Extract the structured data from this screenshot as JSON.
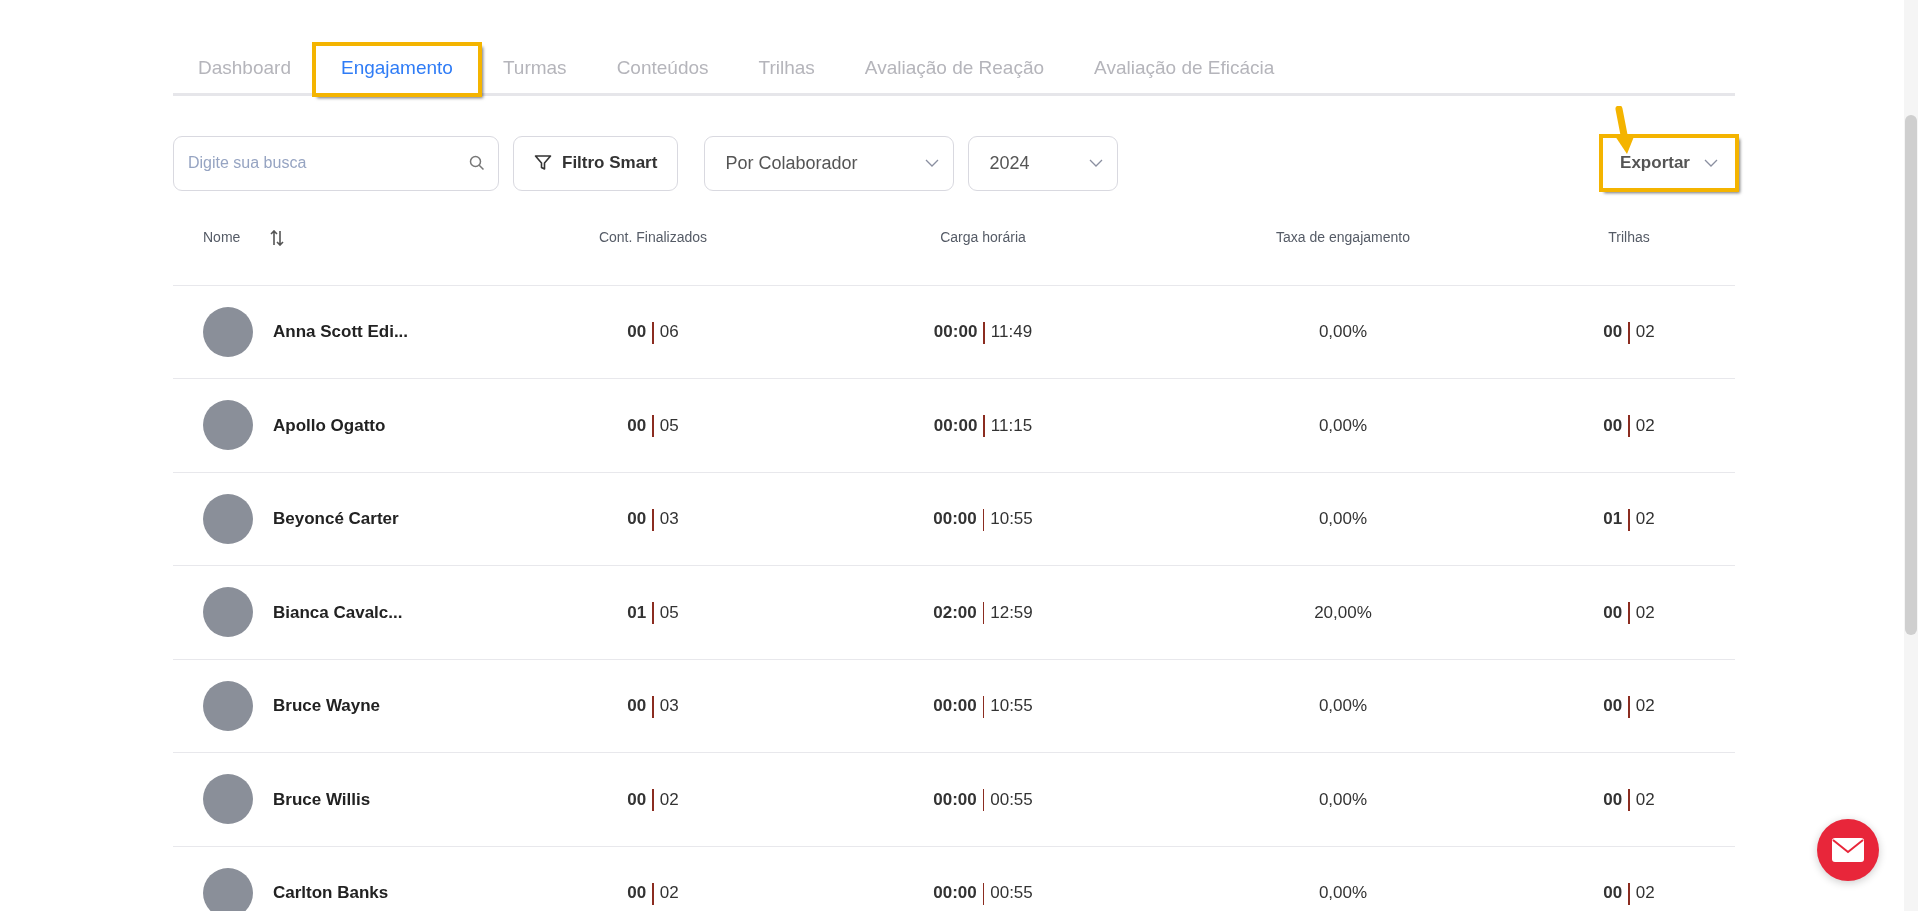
{
  "tabs": [
    {
      "label": "Dashboard",
      "selected": false,
      "highlighted": false
    },
    {
      "label": "Engajamento",
      "selected": true,
      "highlighted": true
    },
    {
      "label": "Turmas",
      "selected": false,
      "highlighted": false
    },
    {
      "label": "Conteúdos",
      "selected": false,
      "highlighted": false
    },
    {
      "label": "Trilhas",
      "selected": false,
      "highlighted": false
    },
    {
      "label": "Avaliação de Reação",
      "selected": false,
      "highlighted": false
    },
    {
      "label": "Avaliação de Eficácia",
      "selected": false,
      "highlighted": false
    }
  ],
  "search": {
    "placeholder": "Digite sua busca"
  },
  "filter_button": "Filtro Smart",
  "group_select": "Por Colaborador",
  "year_select": "2024",
  "export_button": {
    "label": "Exportar",
    "highlighted": true
  },
  "table": {
    "columns": [
      "Nome",
      "Cont. Finalizados",
      "Carga horária",
      "Taxa de engajamento",
      "Trilhas"
    ],
    "rows": [
      {
        "name": "Anna Scott Edi...",
        "contents_done": "00",
        "contents_total": "06",
        "hours_done": "00:00",
        "hours_total": "11:49",
        "rate": "0,00%",
        "trails_done": "00",
        "trails_total": "02"
      },
      {
        "name": "Apollo Ogatto",
        "contents_done": "00",
        "contents_total": "05",
        "hours_done": "00:00",
        "hours_total": "11:15",
        "rate": "0,00%",
        "trails_done": "00",
        "trails_total": "02"
      },
      {
        "name": "Beyoncé Carter",
        "contents_done": "00",
        "contents_total": "03",
        "hours_done": "00:00",
        "hours_total": "10:55",
        "rate": "0,00%",
        "trails_done": "01",
        "trails_total": "02"
      },
      {
        "name": "Bianca Cavalc...",
        "contents_done": "01",
        "contents_total": "05",
        "hours_done": "02:00",
        "hours_total": "12:59",
        "rate": "20,00%",
        "trails_done": "00",
        "trails_total": "02"
      },
      {
        "name": "Bruce Wayne",
        "contents_done": "00",
        "contents_total": "03",
        "hours_done": "00:00",
        "hours_total": "10:55",
        "rate": "0,00%",
        "trails_done": "00",
        "trails_total": "02"
      },
      {
        "name": "Bruce Willis",
        "contents_done": "00",
        "contents_total": "02",
        "hours_done": "00:00",
        "hours_total": "00:55",
        "rate": "0,00%",
        "trails_done": "00",
        "trails_total": "02"
      },
      {
        "name": "Carlton Banks",
        "contents_done": "00",
        "contents_total": "02",
        "hours_done": "00:00",
        "hours_total": "00:55",
        "rate": "0,00%",
        "trails_done": "00",
        "trails_total": "02"
      }
    ]
  }
}
